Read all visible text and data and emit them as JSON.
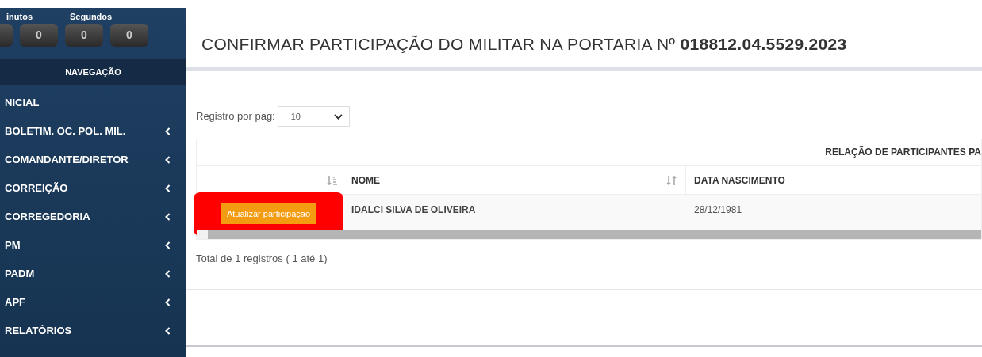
{
  "timer": {
    "labels": [
      "inutos",
      "Segundos"
    ],
    "digits": [
      "0",
      "0",
      "0"
    ]
  },
  "sidebar": {
    "header": "NAVEGAÇÃO",
    "items": [
      {
        "label": "NICIAL",
        "has_submenu": false
      },
      {
        "label": "BOLETIM. OC. POL. MIL.",
        "has_submenu": true
      },
      {
        "label": "COMANDANTE/DIRETOR",
        "has_submenu": true
      },
      {
        "label": "CORREIÇÃO",
        "has_submenu": true
      },
      {
        "label": "CORREGEDORIA",
        "has_submenu": true
      },
      {
        "label": "PM",
        "has_submenu": true
      },
      {
        "label": "PADM",
        "has_submenu": true
      },
      {
        "label": "APF",
        "has_submenu": true
      },
      {
        "label": "RELATÓRIOS",
        "has_submenu": true
      }
    ]
  },
  "page_title": "CONFIRMAR PARTICIPAÇÃO DO MILITAR NA PORTARIA Nº **018812.04.5529.2023**",
  "page_size": {
    "label": "Registro por pag:",
    "value": "10"
  },
  "table": {
    "caption": "RELAÇÃO DE PARTICIPANTES PA",
    "columns": [
      "NOME",
      "DATA NASCIMENTO"
    ],
    "rows": [
      {
        "action": "Atualizar participação",
        "highlighted": true,
        "cells": [
          "IDALCI SILVA DE OLIVEIRA",
          "28/12/1981"
        ]
      }
    ]
  },
  "total": "Total de 1 registros ( 1 até 1)"
}
